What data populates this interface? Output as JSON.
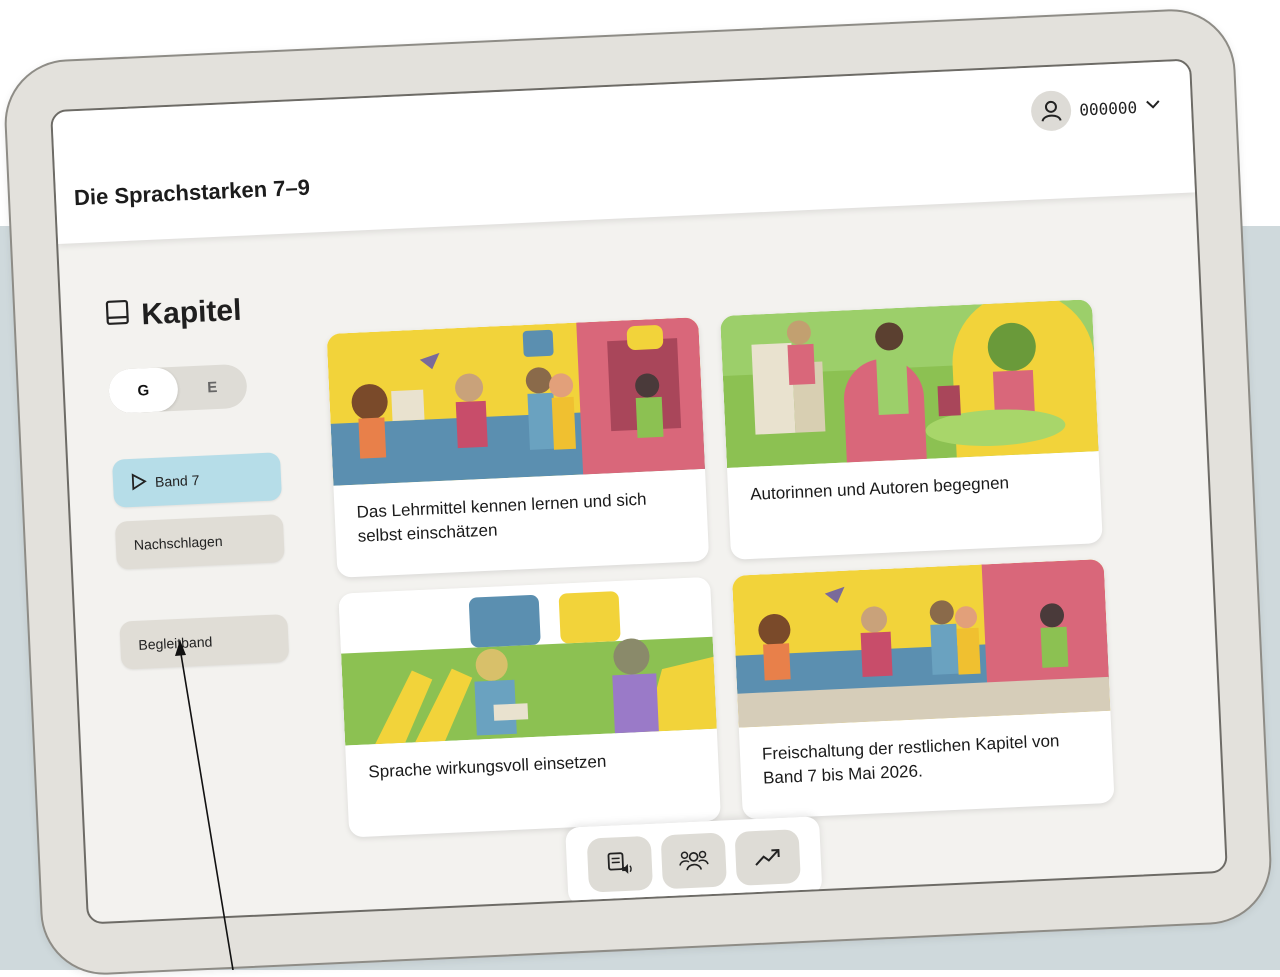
{
  "app": {
    "title": "Die Sprachstarken 7–9"
  },
  "user": {
    "id": "000000",
    "avatar_icon": "user-icon",
    "menu_icon": "chevron-down-icon"
  },
  "section": {
    "title": "Kapitel",
    "icon": "book-icon"
  },
  "level_toggle": {
    "options": [
      "G",
      "E"
    ],
    "selected": "G"
  },
  "sidebar": {
    "items": [
      {
        "label": "Band 7",
        "icon": "play-icon",
        "active": true
      },
      {
        "label": "Nachschlagen",
        "active": false
      },
      {
        "label": "Begleitband",
        "active": false
      }
    ]
  },
  "chapters": [
    {
      "title": "Das Lehrmittel kennen lernen und sich selbst einschätzen"
    },
    {
      "title": "Autorinnen und Autoren begegnen"
    },
    {
      "title": "Sprache wirkungsvoll einsetzen"
    },
    {
      "title": "Freischaltung der restlichen Kapitel von Band 7 bis Mai 2026."
    }
  ],
  "tools": [
    {
      "icon": "text-to-speech-icon"
    },
    {
      "icon": "people-group-icon"
    },
    {
      "icon": "trend-arrow-icon"
    }
  ],
  "colors": {
    "backdrop": "#cfd9dc",
    "bezel": "#e3e1dc",
    "active_nav": "#b6dde8",
    "button_bg": "#e0ddd6",
    "illustration_yellow": "#f2d33a",
    "illustration_green": "#8cc152",
    "illustration_blue": "#5b8fb0",
    "illustration_pink": "#d9677a"
  }
}
